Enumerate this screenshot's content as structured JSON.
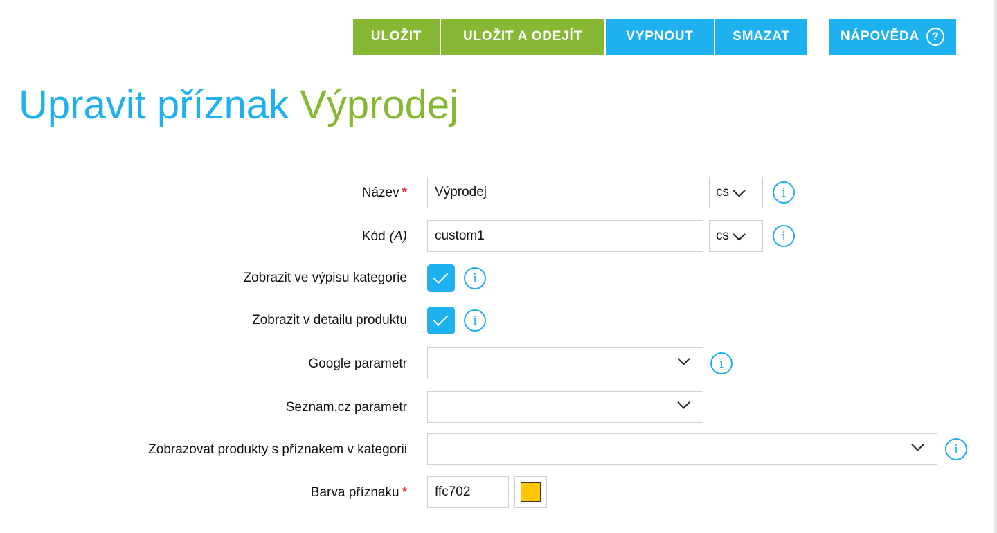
{
  "toolbar": {
    "save_label": "ULOŽIT",
    "save_exit_label": "ULOŽIT A ODEJÍT",
    "disable_label": "VYPNOUT",
    "delete_label": "SMAZAT",
    "help_label": "NÁPOVĚDA",
    "help_symbol": "?"
  },
  "title": {
    "prefix": "Upravit příznak",
    "name": "Výprodej"
  },
  "form": {
    "name": {
      "label": "Název",
      "required_mark": "*",
      "value": "Výprodej",
      "lang": "cs"
    },
    "code": {
      "label": "Kód",
      "hint": "(A)",
      "value": "custom1",
      "lang": "cs"
    },
    "show_in_category_list": {
      "label": "Zobrazit ve výpisu kategorie",
      "checked": true
    },
    "show_in_product_detail": {
      "label": "Zobrazit v detailu produktu",
      "checked": true
    },
    "google_param": {
      "label": "Google parametr",
      "value": ""
    },
    "seznam_param": {
      "label": "Seznam.cz parametr",
      "value": ""
    },
    "show_products_in_category": {
      "label": "Zobrazovat produkty s příznakem v kategorii",
      "value": ""
    },
    "flag_color": {
      "label": "Barva příznaku",
      "required_mark": "*",
      "value": "ffc702",
      "swatch": "#ffc702"
    }
  },
  "icons": {
    "info": "i"
  },
  "colors": {
    "green": "#87b833",
    "blue": "#1fb0ef",
    "required": "#e3262b"
  }
}
